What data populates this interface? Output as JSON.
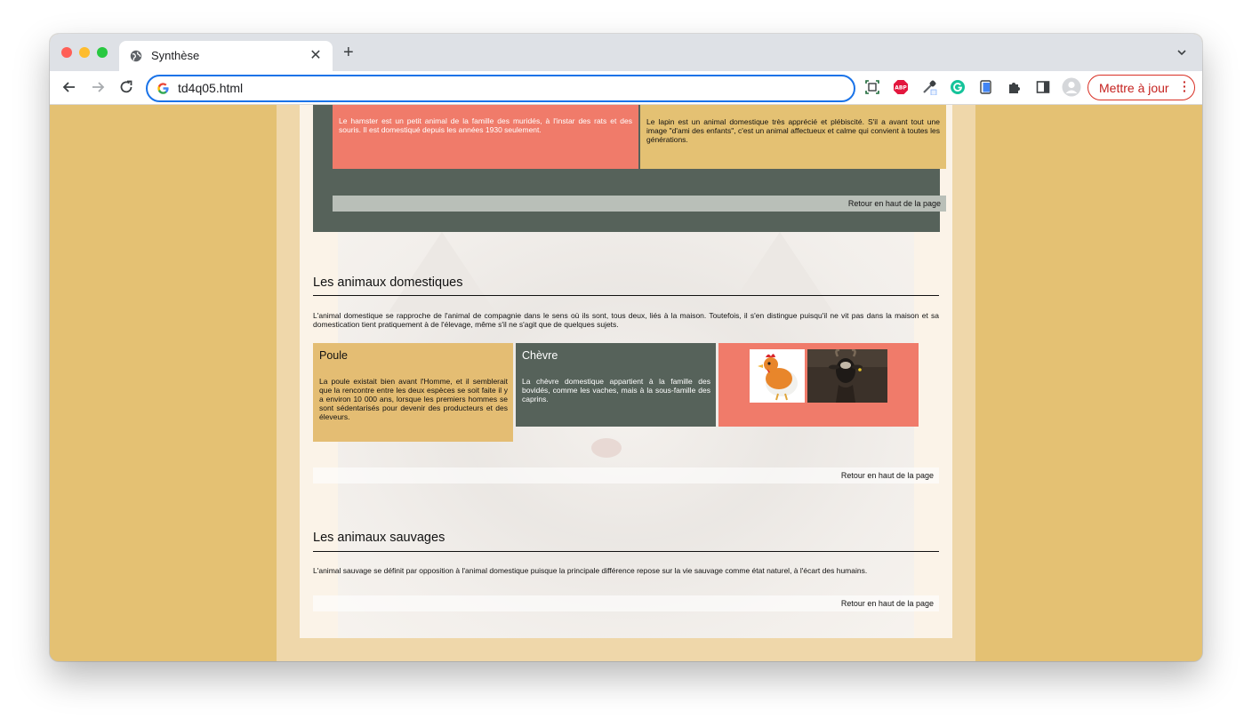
{
  "browser": {
    "tab_title": "Synthèse",
    "url": "td4q05.html",
    "update_button_label": "Mettre à jour",
    "extensions": [
      "screenshot-icon",
      "adblock-icon",
      "eyedropper-icon",
      "grammarly-icon",
      "clipboard-icon",
      "puzzle-icon",
      "sidepanel-icon",
      "profile-icon"
    ]
  },
  "top_section": {
    "hamster_text": "Le hamster est un petit animal de la famille des muridés, à l'instar des rats et des souris. Il est domestiqué depuis les années 1930 seulement.",
    "lapin_text": "Le lapin est un animal domestique très apprécié et plébiscité. S'il a avant tout une image \"d'ami des enfants\", c'est un animal affectueux et calme qui convient à toutes les générations.",
    "back_to_top": "Retour en haut de la page"
  },
  "domestic": {
    "title": "Les animaux domestiques",
    "intro": "L'animal domestique se rapproche de l'animal de compagnie dans le sens où ils sont, tous deux, liés à la maison. Toutefois, il s'en distingue puisqu'il ne vit pas dans la maison et sa domestication tient pratiquement à de l'élevage, même s'il ne s'agit que de quelques sujets.",
    "poule_title": "Poule",
    "poule_text": "La poule existait bien avant l'Homme, et il semblerait que la rencontre entre les deux espèces se soit faite il y a environ 10 000 ans, lorsque les premiers hommes se sont sédentarisés pour devenir des producteurs et des éleveurs.",
    "chevre_title": "Chèvre",
    "chevre_text": "La chèvre domestique appartient à la famille des bovidés, comme les vaches, mais à la sous-famille des caprins.",
    "back_to_top": "Retour en haut de la page"
  },
  "wild": {
    "title": "Les animaux sauvages",
    "intro": "L'animal sauvage se définit par opposition à l'animal domestique puisque la principale différence repose sur la vie sauvage comme état naturel, à l'écart des humains.",
    "back_to_top": "Retour en haut de la page"
  },
  "colors": {
    "accent_gold": "#e4c173",
    "accent_salmon": "#f07b6a",
    "accent_slate": "#56625a"
  }
}
